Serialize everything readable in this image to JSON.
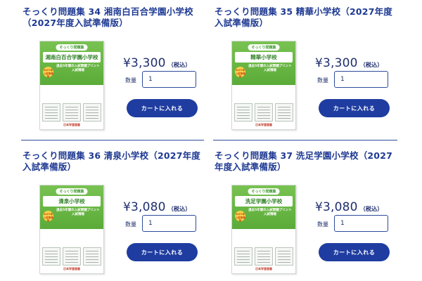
{
  "products": [
    {
      "title": "そっくり問題集 34 湘南白百合学園小学校（2027年度入試準備版）",
      "cover_school": "湘南白百合学園小学校",
      "price": "¥3,300",
      "tax": "（税込）",
      "qty_label": "数量",
      "qty_value": "1",
      "cart_label": "カートに入れる"
    },
    {
      "title": "そっくり問題集 35 精華小学校（2027年度入試準備版）",
      "cover_school": "精華小学校",
      "price": "¥3,300",
      "tax": "（税込）",
      "qty_label": "数量",
      "qty_value": "1",
      "cart_label": "カートに入れる"
    },
    {
      "title": "そっくり問題集 36 清泉小学校（2027年度入試準備版）",
      "cover_school": "清泉小学校",
      "price": "¥3,080",
      "tax": "（税込）",
      "qty_label": "数量",
      "qty_value": "1",
      "cart_label": "カートに入れる"
    },
    {
      "title": "そっくり問題集 37 洗足学園小学校（2027年度入試準備版）",
      "cover_school": "洗足学園小学校",
      "price": "¥3,080",
      "tax": "（税込）",
      "qty_label": "数量",
      "qty_value": "1",
      "cart_label": "カートに入れる"
    }
  ],
  "cover": {
    "series": "そっくり問題集",
    "subtitle": "過去5年間の入試問題プリント入試情報",
    "badge": "2027年入試準備版",
    "publisher": "日本学習図書"
  },
  "colors": {
    "navy": "#1f3ca0",
    "title_blue": "#1f3a93",
    "cover_green": "#5bab39"
  }
}
